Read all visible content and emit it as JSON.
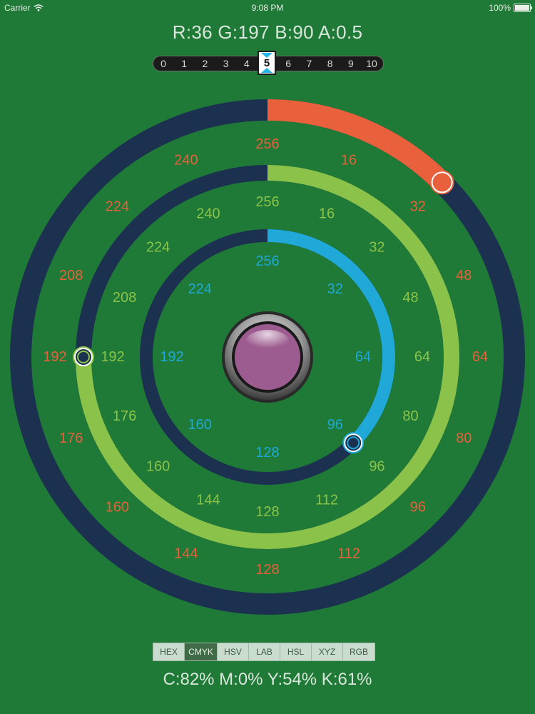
{
  "status_bar": {
    "carrier": "Carrier",
    "time": "9:08 PM",
    "battery": "100%"
  },
  "color_readout": "R:36 G:197 B:90 A:0.5",
  "scale_slider": {
    "labels": [
      "0",
      "1",
      "2",
      "3",
      "4",
      "5",
      "6",
      "7",
      "8",
      "9",
      "10"
    ],
    "selected": "5"
  },
  "rings": {
    "red": {
      "color": "#e8603c",
      "value": 32,
      "labels": [
        "256",
        "16",
        "32",
        "48",
        "64",
        "80",
        "96",
        "112",
        "128",
        "144",
        "160",
        "176",
        "192",
        "208",
        "224",
        "240"
      ]
    },
    "green": {
      "color": "#8bc34a",
      "value": 192,
      "labels": [
        "256",
        "16",
        "32",
        "48",
        "64",
        "80",
        "96",
        "112",
        "128",
        "144",
        "160",
        "176",
        "192",
        "208",
        "224",
        "240"
      ]
    },
    "blue": {
      "color": "#1fa8d8",
      "value": 96,
      "labels": [
        "256",
        "32",
        "64",
        "96",
        "128",
        "160",
        "192",
        "224"
      ]
    },
    "track_color": "#1c3150"
  },
  "preview_color": "#9d5c8f",
  "format_tabs": {
    "items": [
      "HEX",
      "CMYK",
      "HSV",
      "LAB",
      "HSL",
      "XYZ",
      "RGB"
    ],
    "selected": "CMYK"
  },
  "converted_readout": "C:82% M:0% Y:54% K:61%"
}
